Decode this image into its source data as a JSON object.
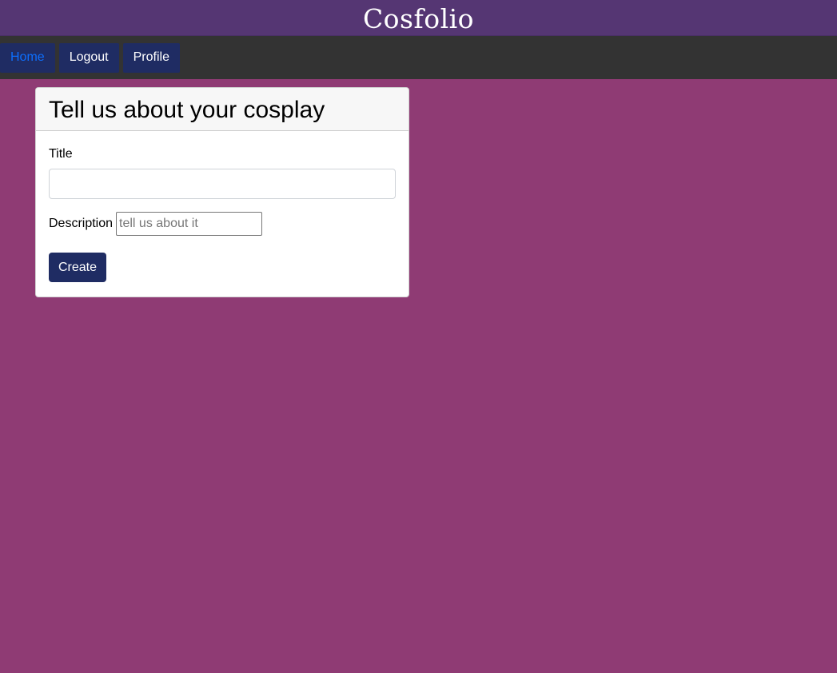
{
  "brand": {
    "title": "Cosfolio"
  },
  "nav": {
    "items": [
      {
        "label": "Home",
        "active": true
      },
      {
        "label": "Logout",
        "active": false
      },
      {
        "label": "Profile",
        "active": false
      }
    ]
  },
  "form": {
    "header": "Tell us about your cosplay",
    "title_label": "Title",
    "title_value": "",
    "description_label": "Description",
    "description_placeholder": "tell us about it",
    "description_value": "",
    "submit_label": "Create"
  },
  "colors": {
    "brand_bar": "#553673",
    "nav_bar": "#333333",
    "button": "#1f2c63",
    "page_background": "#8f3b74",
    "active_link": "#0d6efd"
  }
}
